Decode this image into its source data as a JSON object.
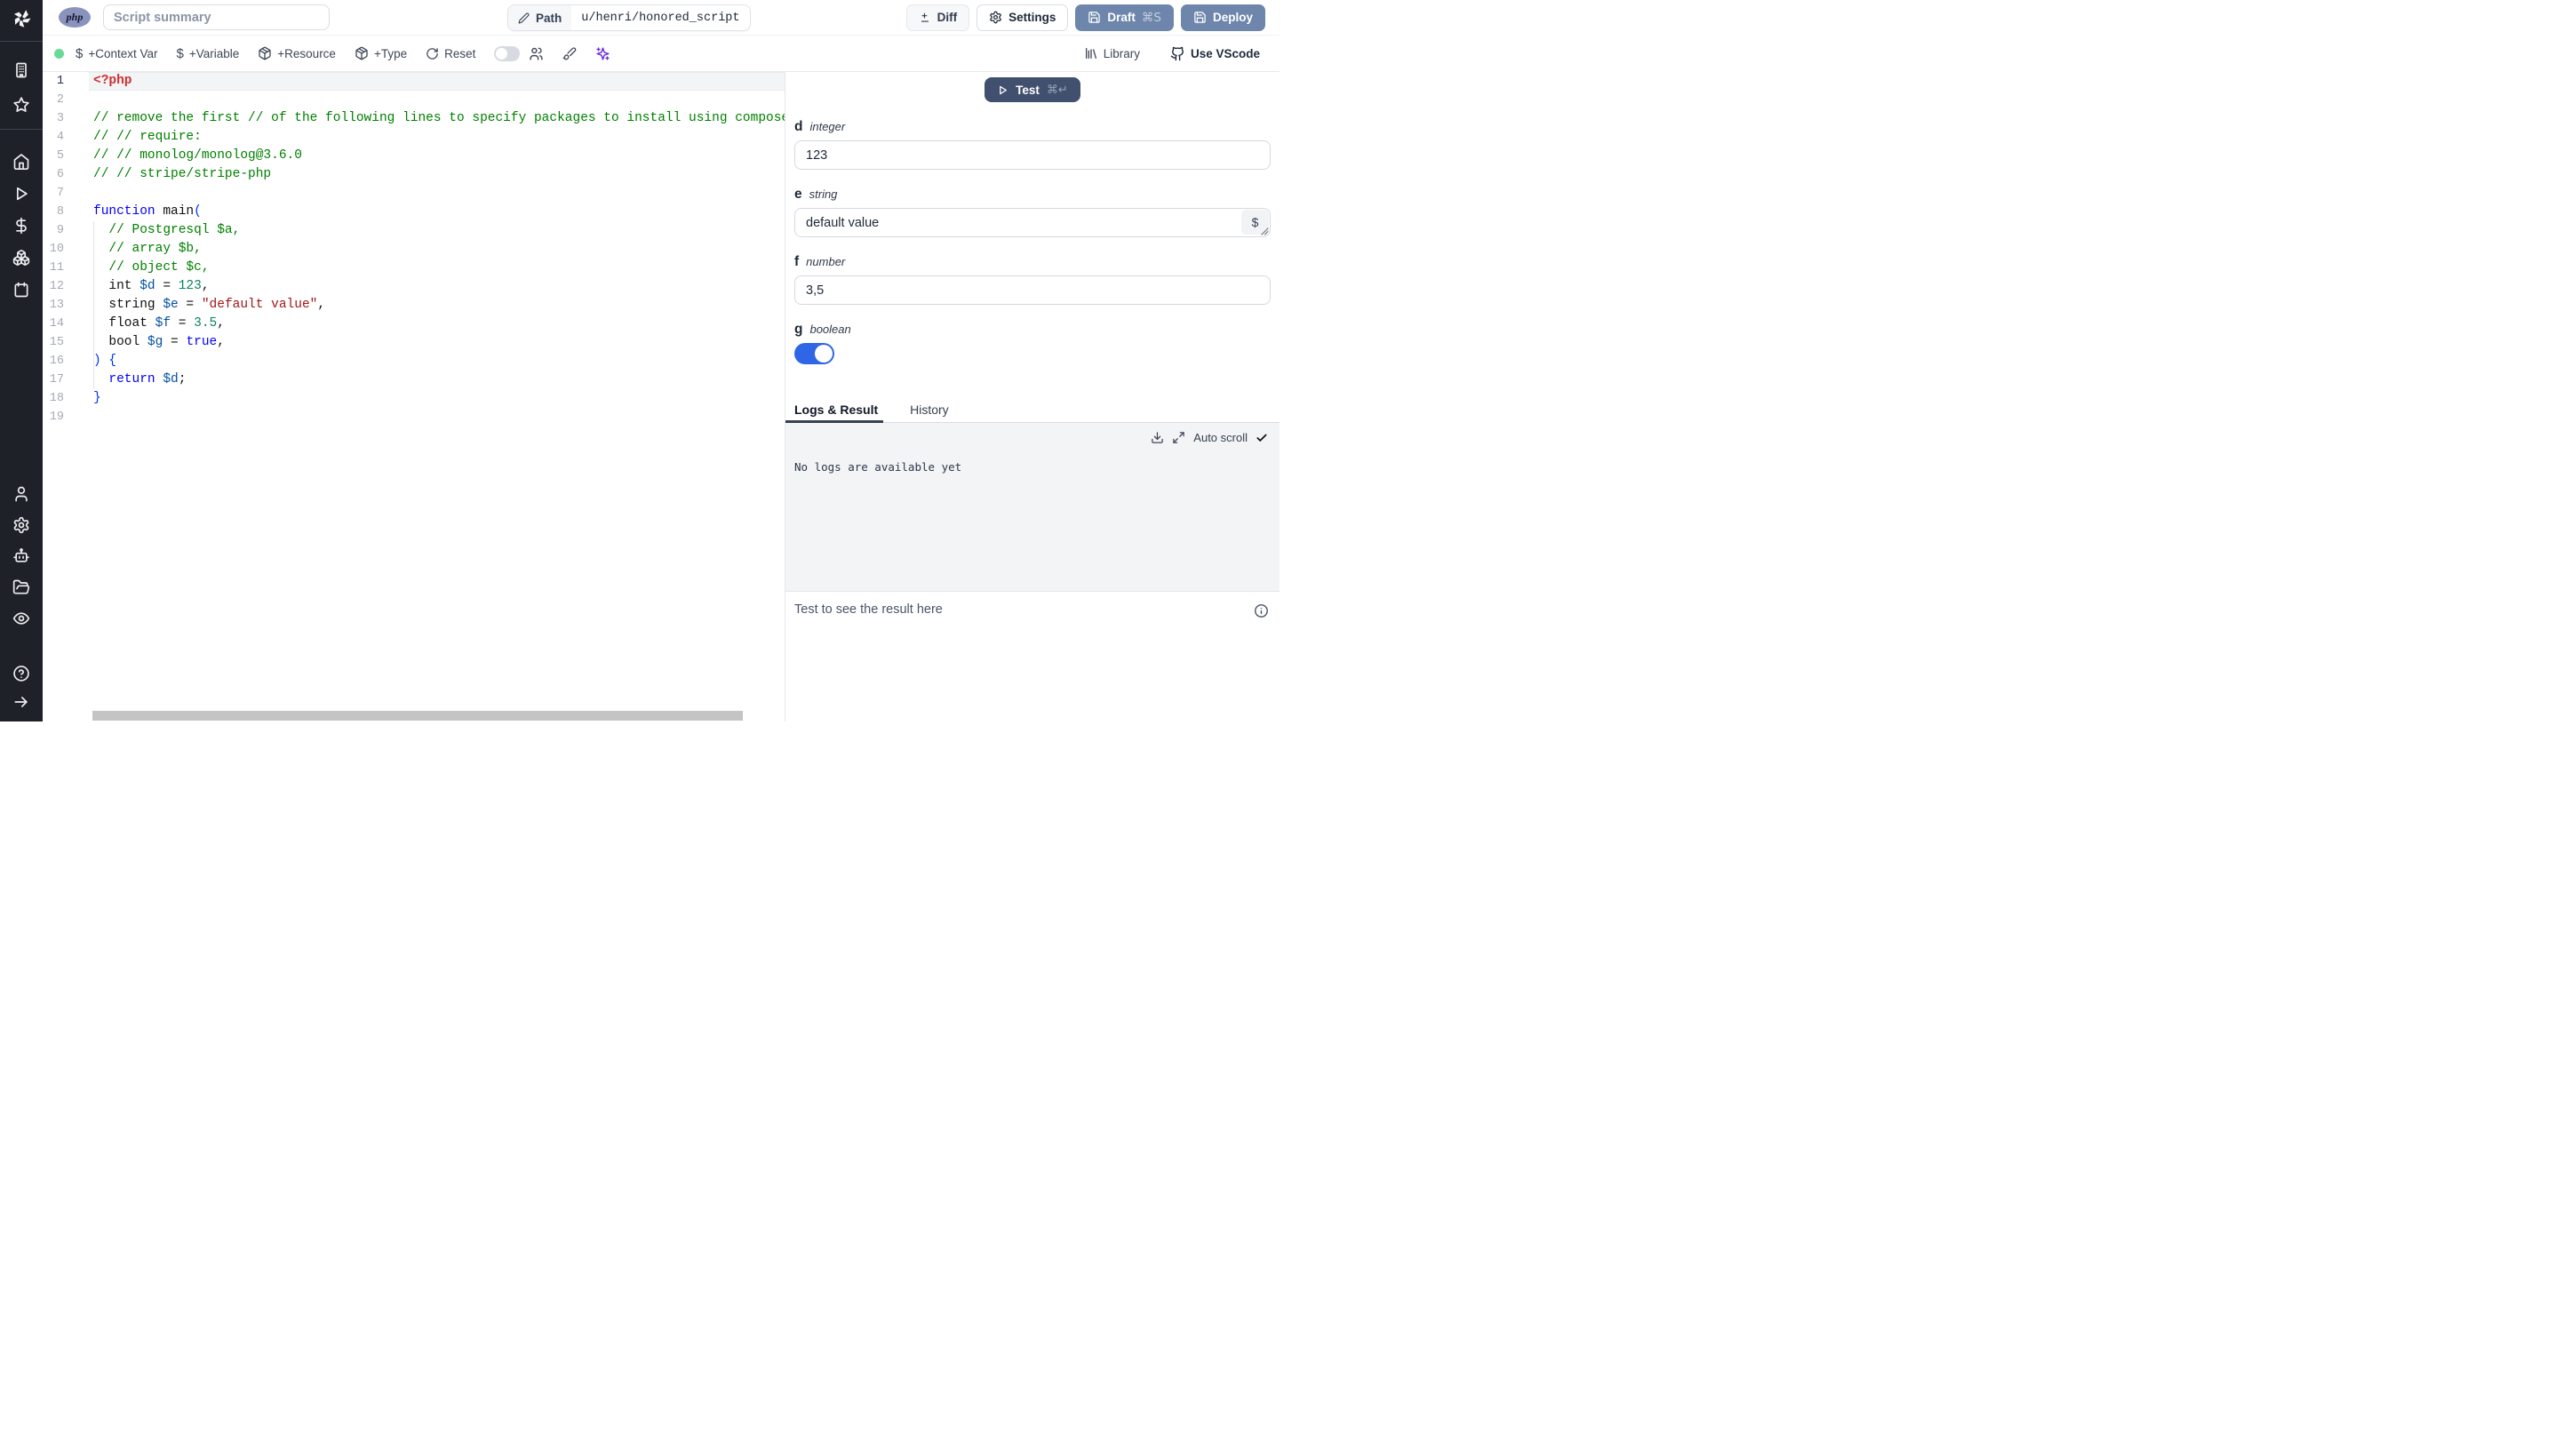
{
  "topbar": {
    "language_badge": "php",
    "summary_placeholder": "Script summary",
    "path_label": "Path",
    "path_value": "u/henri/honored_script",
    "diff_label": "Diff",
    "settings_label": "Settings",
    "draft_label": "Draft",
    "draft_shortcut": "⌘S",
    "deploy_label": "Deploy"
  },
  "toolbar": {
    "context_var_label": "+Context Var",
    "variable_label": "+Variable",
    "resource_label": "+Resource",
    "type_label": "+Type",
    "reset_label": "Reset",
    "library_label": "Library",
    "vscode_label": "Use VScode"
  },
  "sidebar": {
    "icons_top": [
      "building",
      "star"
    ],
    "icons_main": [
      "home",
      "play",
      "dollar-sign",
      "boxes",
      "calendar"
    ],
    "icons_account": [
      "user",
      "gear",
      "robot",
      "folder-open",
      "eye"
    ],
    "icons_bottom": [
      "help-circle",
      "arrow-right"
    ]
  },
  "editor": {
    "language": "php",
    "lines": [
      {
        "n": 1,
        "tokens": [
          [
            "<?php",
            "tag"
          ]
        ]
      },
      {
        "n": 2,
        "tokens": []
      },
      {
        "n": 3,
        "tokens": [
          [
            "// remove the first // of the following lines to specify packages to install using composer",
            "com"
          ]
        ]
      },
      {
        "n": 4,
        "tokens": [
          [
            "// // require:",
            "com"
          ]
        ]
      },
      {
        "n": 5,
        "tokens": [
          [
            "// // monolog/monolog@3.6.0",
            "com"
          ]
        ]
      },
      {
        "n": 6,
        "tokens": [
          [
            "// // stripe/stripe-php",
            "com"
          ]
        ]
      },
      {
        "n": 7,
        "tokens": []
      },
      {
        "n": 8,
        "tokens": [
          [
            "function",
            "kw"
          ],
          [
            " main",
            "def"
          ],
          [
            "(",
            "brk"
          ]
        ]
      },
      {
        "n": 9,
        "tokens": [
          [
            "  ",
            "def"
          ],
          [
            "// Postgresql $a,",
            "com"
          ]
        ]
      },
      {
        "n": 10,
        "tokens": [
          [
            "  ",
            "def"
          ],
          [
            "// array $b,",
            "com"
          ]
        ]
      },
      {
        "n": 11,
        "tokens": [
          [
            "  ",
            "def"
          ],
          [
            "// object $c,",
            "com"
          ]
        ]
      },
      {
        "n": 12,
        "tokens": [
          [
            "  int ",
            "def"
          ],
          [
            "$d",
            "var"
          ],
          [
            " = ",
            "def"
          ],
          [
            "123",
            "num"
          ],
          [
            ",",
            "def"
          ]
        ]
      },
      {
        "n": 13,
        "tokens": [
          [
            "  string ",
            "def"
          ],
          [
            "$e",
            "var"
          ],
          [
            " = ",
            "def"
          ],
          [
            "\"default value\"",
            "str"
          ],
          [
            ",",
            "def"
          ]
        ]
      },
      {
        "n": 14,
        "tokens": [
          [
            "  float ",
            "def"
          ],
          [
            "$f",
            "var"
          ],
          [
            " = ",
            "def"
          ],
          [
            "3.5",
            "num"
          ],
          [
            ",",
            "def"
          ]
        ]
      },
      {
        "n": 15,
        "tokens": [
          [
            "  bool ",
            "def"
          ],
          [
            "$g",
            "var"
          ],
          [
            " = ",
            "def"
          ],
          [
            "true",
            "kw"
          ],
          [
            ",",
            "def"
          ]
        ]
      },
      {
        "n": 16,
        "tokens": [
          [
            ") {",
            "brk"
          ]
        ]
      },
      {
        "n": 17,
        "tokens": [
          [
            "  ",
            "def"
          ],
          [
            "return",
            "kw"
          ],
          [
            " ",
            "def"
          ],
          [
            "$d",
            "var"
          ],
          [
            ";",
            "def"
          ]
        ]
      },
      {
        "n": 18,
        "tokens": [
          [
            "}",
            "brk"
          ]
        ]
      },
      {
        "n": 19,
        "tokens": []
      }
    ]
  },
  "panel": {
    "test_label": "Test",
    "test_shortcut": "⌘↵",
    "fields": [
      {
        "name": "d",
        "type": "integer",
        "value": "123"
      },
      {
        "name": "e",
        "type": "string",
        "value": "default value",
        "picker": "$"
      },
      {
        "name": "f",
        "type": "number",
        "value": "3,5"
      },
      {
        "name": "g",
        "type": "boolean",
        "value": "true"
      }
    ],
    "tabs": [
      {
        "label": "Logs & Result",
        "active": true
      },
      {
        "label": "History",
        "active": false
      }
    ],
    "logs": {
      "auto_scroll_label": "Auto scroll",
      "empty_message": "No logs are available yet"
    },
    "result_placeholder": "Test to see the result here"
  },
  "colors": {
    "sidebar_bg": "#1f2128",
    "test_button": "#41506e",
    "deploy_button": "#6e86ac",
    "toggle_on": "#2e66e5",
    "ai_icon": "#6d28d9",
    "status_dot": "#69da95",
    "tab_underline": "#38414f"
  }
}
